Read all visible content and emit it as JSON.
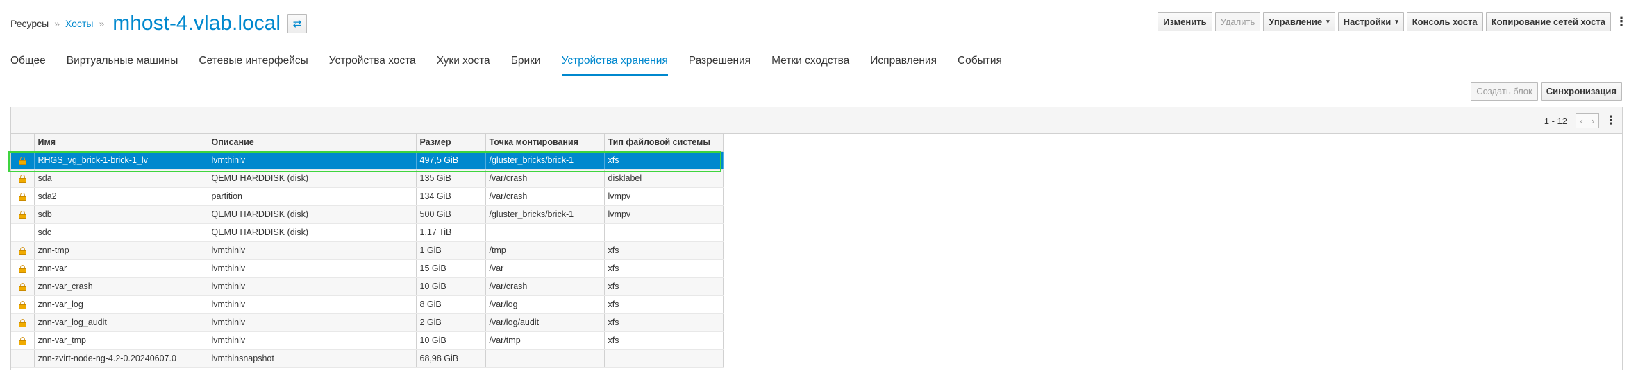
{
  "breadcrumb": {
    "root": "Ресурсы",
    "hosts": "Хосты",
    "separator": "»",
    "title": "mhost-4.vlab.local"
  },
  "header_actions": {
    "edit": "Изменить",
    "remove": "Удалить",
    "management": "Управление",
    "settings": "Настройки",
    "host_console": "Консоль хоста",
    "copy_host_networks": "Копирование сетей хоста"
  },
  "tabs": [
    {
      "label": "Общее",
      "active": false
    },
    {
      "label": "Виртуальные машины",
      "active": false
    },
    {
      "label": "Сетевые интерфейсы",
      "active": false
    },
    {
      "label": "Устройства хоста",
      "active": false
    },
    {
      "label": "Хуки хоста",
      "active": false
    },
    {
      "label": "Брики",
      "active": false
    },
    {
      "label": "Устройства хранения",
      "active": true
    },
    {
      "label": "Разрешения",
      "active": false
    },
    {
      "label": "Метки сходства",
      "active": false
    },
    {
      "label": "Исправления",
      "active": false
    },
    {
      "label": "События",
      "active": false
    }
  ],
  "storage_actions": {
    "create_brick": "Создать блок",
    "sync": "Синхронизация"
  },
  "pager": {
    "range": "1 - 12",
    "prev": "‹",
    "next": "›"
  },
  "columns": {
    "name": "Имя",
    "description": "Описание",
    "size": "Размер",
    "mount_point": "Точка монтирования",
    "fs_type": "Тип файловой системы"
  },
  "rows": [
    {
      "locked": true,
      "name": "RHGS_vg_brick-1-brick-1_lv",
      "description": "lvmthinlv",
      "size": "497,5 GiB",
      "mount": "/gluster_bricks/brick-1",
      "fs": "xfs",
      "selected": true
    },
    {
      "locked": true,
      "name": "sda",
      "description": "QEMU HARDDISK (disk)",
      "size": "135 GiB",
      "mount": "/var/crash",
      "fs": "disklabel",
      "selected": false
    },
    {
      "locked": true,
      "name": "sda2",
      "description": "partition",
      "size": "134 GiB",
      "mount": "/var/crash",
      "fs": "lvmpv",
      "selected": false
    },
    {
      "locked": true,
      "name": "sdb",
      "description": "QEMU HARDDISK (disk)",
      "size": "500 GiB",
      "mount": "/gluster_bricks/brick-1",
      "fs": "lvmpv",
      "selected": false
    },
    {
      "locked": false,
      "name": "sdc",
      "description": "QEMU HARDDISK (disk)",
      "size": "1,17 TiB",
      "mount": "",
      "fs": "",
      "selected": false
    },
    {
      "locked": true,
      "name": "znn-tmp",
      "description": "lvmthinlv",
      "size": "1 GiB",
      "mount": "/tmp",
      "fs": "xfs",
      "selected": false
    },
    {
      "locked": true,
      "name": "znn-var",
      "description": "lvmthinlv",
      "size": "15 GiB",
      "mount": "/var",
      "fs": "xfs",
      "selected": false
    },
    {
      "locked": true,
      "name": "znn-var_crash",
      "description": "lvmthinlv",
      "size": "10 GiB",
      "mount": "/var/crash",
      "fs": "xfs",
      "selected": false
    },
    {
      "locked": true,
      "name": "znn-var_log",
      "description": "lvmthinlv",
      "size": "8 GiB",
      "mount": "/var/log",
      "fs": "xfs",
      "selected": false
    },
    {
      "locked": true,
      "name": "znn-var_log_audit",
      "description": "lvmthinlv",
      "size": "2 GiB",
      "mount": "/var/log/audit",
      "fs": "xfs",
      "selected": false
    },
    {
      "locked": true,
      "name": "znn-var_tmp",
      "description": "lvmthinlv",
      "size": "10 GiB",
      "mount": "/var/tmp",
      "fs": "xfs",
      "selected": false
    },
    {
      "locked": false,
      "name": "znn-zvirt-node-ng-4.2-0.20240607.0",
      "description": "lvmthinsnapshot",
      "size": "68,98 GiB",
      "mount": "",
      "fs": "",
      "selected": false
    }
  ],
  "icons": {
    "lock": "lock-icon",
    "switch": "swap-arrows-icon",
    "kebab": "kebab-menu-icon",
    "caret": "chevron-down-icon"
  },
  "colors": {
    "accent": "#0088ce",
    "selected_row": "#0088ce",
    "highlight_outline": "#3fd43f",
    "lock": "#f0ab00"
  }
}
